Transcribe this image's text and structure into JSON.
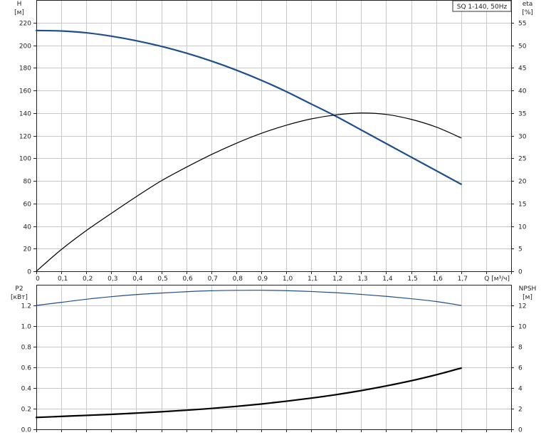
{
  "legend_label": "SQ 1-140, 50Hz",
  "chart_data": [
    {
      "type": "line",
      "x_label": "Q [м³/ч]",
      "x_ticks": [
        "0",
        "0,1",
        "0,2",
        "0,3",
        "0,4",
        "0,5",
        "0,6",
        "0,7",
        "0,8",
        "0,9",
        "1,0",
        "1,1",
        "1,2",
        "1,3",
        "1,4",
        "1,5",
        "1,6",
        "1,7"
      ],
      "x_range": [
        0,
        1.9
      ],
      "left_axis": {
        "label_top": "H",
        "label_unit": "[м]",
        "range": [
          0,
          240
        ],
        "ticks": [
          "0",
          "20",
          "40",
          "60",
          "80",
          "100",
          "120",
          "140",
          "160",
          "180",
          "200",
          "220"
        ]
      },
      "right_axis": {
        "label_top": "eta",
        "label_unit": "[%]",
        "range": [
          0,
          60
        ],
        "ticks": [
          "0",
          "5",
          "10",
          "15",
          "20",
          "25",
          "30",
          "35",
          "40",
          "45",
          "50",
          "55"
        ]
      },
      "grid": true,
      "series": [
        {
          "color": "#1f4e8c",
          "axis": "left",
          "stroke": 2.2,
          "x": [
            0,
            0.1,
            0.2,
            0.3,
            0.4,
            0.5,
            0.6,
            0.7,
            0.8,
            0.9,
            1.0,
            1.1,
            1.2,
            1.3,
            1.4,
            1.5,
            1.6,
            1.7
          ],
          "y": [
            213,
            212.6,
            211,
            208,
            204,
            199,
            193,
            186,
            178,
            169,
            159,
            148,
            137,
            125,
            113,
            101,
            89,
            77
          ]
        },
        {
          "color": "#000000",
          "axis": "right",
          "stroke": 1.2,
          "x": [
            0,
            0.1,
            0.2,
            0.3,
            0.4,
            0.5,
            0.6,
            0.7,
            0.8,
            0.9,
            1.0,
            1.1,
            1.2,
            1.3,
            1.4,
            1.5,
            1.6,
            1.7
          ],
          "y": [
            0,
            4.8,
            9.0,
            12.8,
            16.5,
            20.0,
            23.0,
            25.8,
            28.3,
            30.5,
            32.3,
            33.7,
            34.6,
            35.0,
            34.7,
            33.6,
            31.9,
            29.5
          ]
        }
      ]
    },
    {
      "type": "line",
      "x_range": [
        0,
        1.9
      ],
      "left_axis": {
        "label_top": "P2",
        "label_unit": "[кВт]",
        "range": [
          0,
          1.4
        ],
        "ticks": [
          "0.0",
          "0.2",
          "0.4",
          "0.6",
          "0.8",
          "1.0",
          "1.2"
        ]
      },
      "right_axis": {
        "label_top": "NPSH",
        "label_unit": "[м]",
        "range": [
          0,
          14
        ],
        "ticks": [
          "0",
          "2",
          "4",
          "6",
          "8",
          "10",
          "12"
        ]
      },
      "grid": true,
      "series": [
        {
          "color": "#1f4e8c",
          "axis": "left",
          "stroke": 1.2,
          "x": [
            0,
            0.1,
            0.2,
            0.3,
            0.4,
            0.5,
            0.6,
            0.7,
            0.8,
            0.9,
            1.0,
            1.1,
            1.2,
            1.3,
            1.4,
            1.5,
            1.6,
            1.7
          ],
          "y": [
            1.2,
            1.23,
            1.26,
            1.285,
            1.305,
            1.32,
            1.333,
            1.342,
            1.346,
            1.347,
            1.343,
            1.335,
            1.323,
            1.307,
            1.288,
            1.265,
            1.238,
            1.2
          ]
        },
        {
          "color": "#000000",
          "axis": "left",
          "stroke": 2.2,
          "x": [
            0,
            0.1,
            0.2,
            0.3,
            0.4,
            0.5,
            0.6,
            0.7,
            0.8,
            0.9,
            1.0,
            1.1,
            1.2,
            1.3,
            1.4,
            1.5,
            1.6,
            1.7
          ],
          "y": [
            0.115,
            0.125,
            0.135,
            0.145,
            0.157,
            0.17,
            0.185,
            0.202,
            0.222,
            0.245,
            0.272,
            0.302,
            0.336,
            0.375,
            0.42,
            0.47,
            0.528,
            0.593
          ]
        }
      ]
    }
  ]
}
